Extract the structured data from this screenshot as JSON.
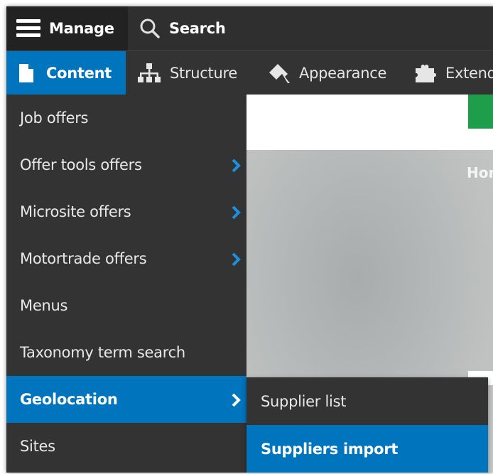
{
  "toolbar": {
    "manage_label": "Manage",
    "search_label": "Search"
  },
  "tray": [
    {
      "label": "Content",
      "icon": "document-icon"
    },
    {
      "label": "Structure",
      "icon": "structure-icon"
    },
    {
      "label": "Appearance",
      "icon": "paint-brush-icon"
    },
    {
      "label": "Extend",
      "icon": "puzzle-icon"
    }
  ],
  "content_menu": [
    {
      "label": "Job offers",
      "has_children": false
    },
    {
      "label": "Offer tools offers",
      "has_children": true
    },
    {
      "label": "Microsite offers",
      "has_children": true
    },
    {
      "label": "Motortrade offers",
      "has_children": true
    },
    {
      "label": "Menus",
      "has_children": false
    },
    {
      "label": "Taxonomy term search",
      "has_children": false
    },
    {
      "label": "Geolocation",
      "has_children": true,
      "active": true
    },
    {
      "label": "Sites",
      "has_children": false
    }
  ],
  "geolocation_submenu": [
    {
      "label": "Supplier list"
    },
    {
      "label": "Suppliers import",
      "active": true
    }
  ],
  "page": {
    "hero_text": "Hor"
  },
  "colors": {
    "accent": "#0074bd",
    "toolbar_bg": "#2f2f2f",
    "tray_bg": "#333333",
    "green": "#1e9e4a"
  }
}
